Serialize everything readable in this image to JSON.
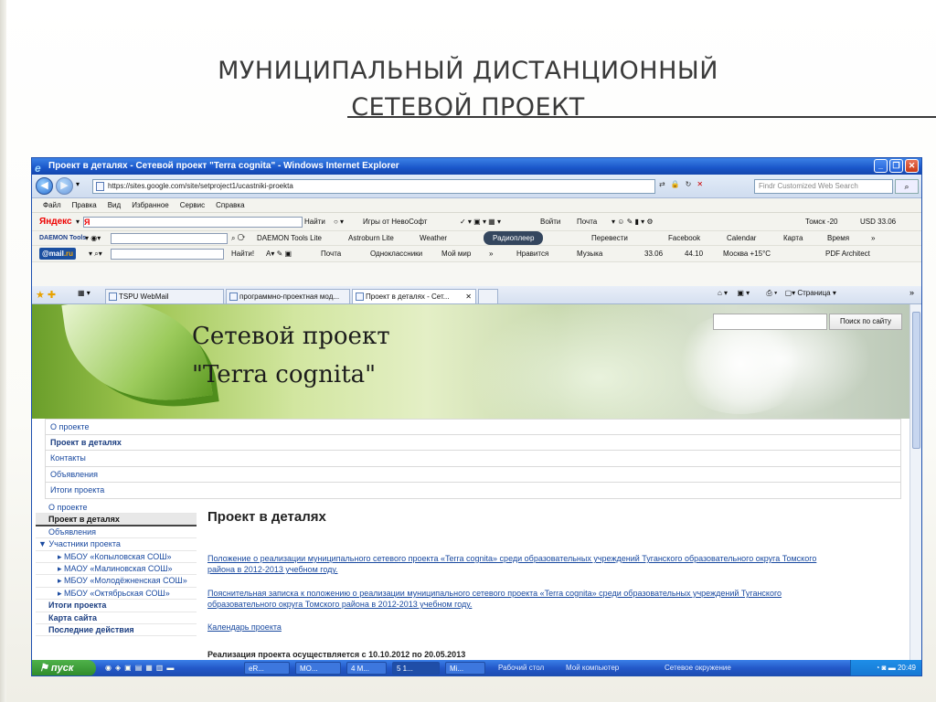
{
  "slide": {
    "title_line1": "МУНИЦИПАЛЬНЫЙ ДИСТАНЦИОННЫЙ",
    "title_line2": "СЕТЕВОЙ ПРОЕКТ"
  },
  "browser": {
    "window_title": "Проект в деталях - Сетевой проект \"Terra cognita\" - Windows Internet Explorer",
    "address": "https://sites.google.com/site/setproject1/ucastniki-proekta",
    "search_placeholder": "Findr Customized Web Search",
    "menu": [
      "Файл",
      "Правка",
      "Вид",
      "Избранное",
      "Сервис",
      "Справка"
    ],
    "yandex_toolbar": {
      "logo_left": "Яндекс",
      "logo_right": "Я",
      "find_button": "Найти",
      "games": "Игры от НевоСофт",
      "login": "Войти",
      "mail": "Почта",
      "weather_info": "Томск -20",
      "currency": "USD 33.06"
    },
    "daemon_toolbar": {
      "logo": "DAEMON Tools",
      "daemon_lite": "DAEMON Tools Lite",
      "astroburn": "Astroburn Lite",
      "weather": "Weather",
      "radio": "Радиоплеер",
      "translate": "Перевести",
      "facebook": "Facebook",
      "calendar": "Calendar",
      "map": "Карта",
      "time": "Время"
    },
    "mail_toolbar": {
      "logo_prefix": "@mail",
      "logo_suffix": ".ru",
      "find_button": "Найти!",
      "mail": "Почта",
      "odnoklassniki": "Одноклассники",
      "moi_mir": "Мой мир",
      "like": "Нравится",
      "music": "Музыка",
      "usd": "33.06",
      "eur": "44.10",
      "weather": "Москва +15°C",
      "pdf": "PDF Architect"
    },
    "tabs": [
      {
        "label": "TSPU WebMail"
      },
      {
        "label": "программно-проектная мод..."
      },
      {
        "label": "Проект в деталях - Сет..."
      }
    ],
    "page_menu": "Страница"
  },
  "site": {
    "banner_line1": "Сетевой проект",
    "banner_line2": "\"Terra cognita\"",
    "search_button": "Поиск по сайту",
    "top_nav": [
      "О проекте",
      "Проект в деталях",
      "Контакты",
      "Объявления",
      "Итоги проекта"
    ],
    "sidebar": [
      {
        "label": "О проекте"
      },
      {
        "label": "Проект в деталях"
      },
      {
        "label": "Объявления"
      },
      {
        "label": "▼ Участники проекта"
      },
      {
        "label": "▸ МБОУ «Копыловская СОШ»"
      },
      {
        "label": "▸ МАОУ «Малиновская СОШ»"
      },
      {
        "label": "▸ МБОУ «Молодёжненская СОШ»"
      },
      {
        "label": "▸ МБОУ «Октябрьская СОШ»"
      },
      {
        "label": "Итоги проекта"
      },
      {
        "label": "Карта сайта"
      },
      {
        "label": "Последние действия"
      }
    ],
    "content": {
      "title": "Проект в деталях",
      "links": [
        {
          "line1": "Положение о  реализации муниципального сетевого проекта «Terra cognita» среди образовательных учреждений Туганского образовательного округа Томского",
          "line2": "района в 2012-2013 учебном году."
        },
        {
          "line1": "Пояснительная записка к положению о  реализации муниципального сетевого проекта «Terra cognita» среди образовательных учреждений Туганского",
          "line2": "образовательного округа Томского района в 2012-2013 учебном году."
        },
        {
          "line1": "Календарь проекта",
          "line2": ""
        }
      ],
      "cut_text": "Реализация проекта осуществляется с 10.10.2012 по 20.05.2013"
    }
  },
  "taskbar": {
    "start": "пуск",
    "tasks": [
      "eR...",
      "МО...",
      "4 М...",
      "5 1...",
      "Mi..."
    ],
    "desktop": "Рабочий стол",
    "my_computer": "Мой компьютер",
    "network": "Сетевое окружение",
    "clock": "20:49"
  }
}
